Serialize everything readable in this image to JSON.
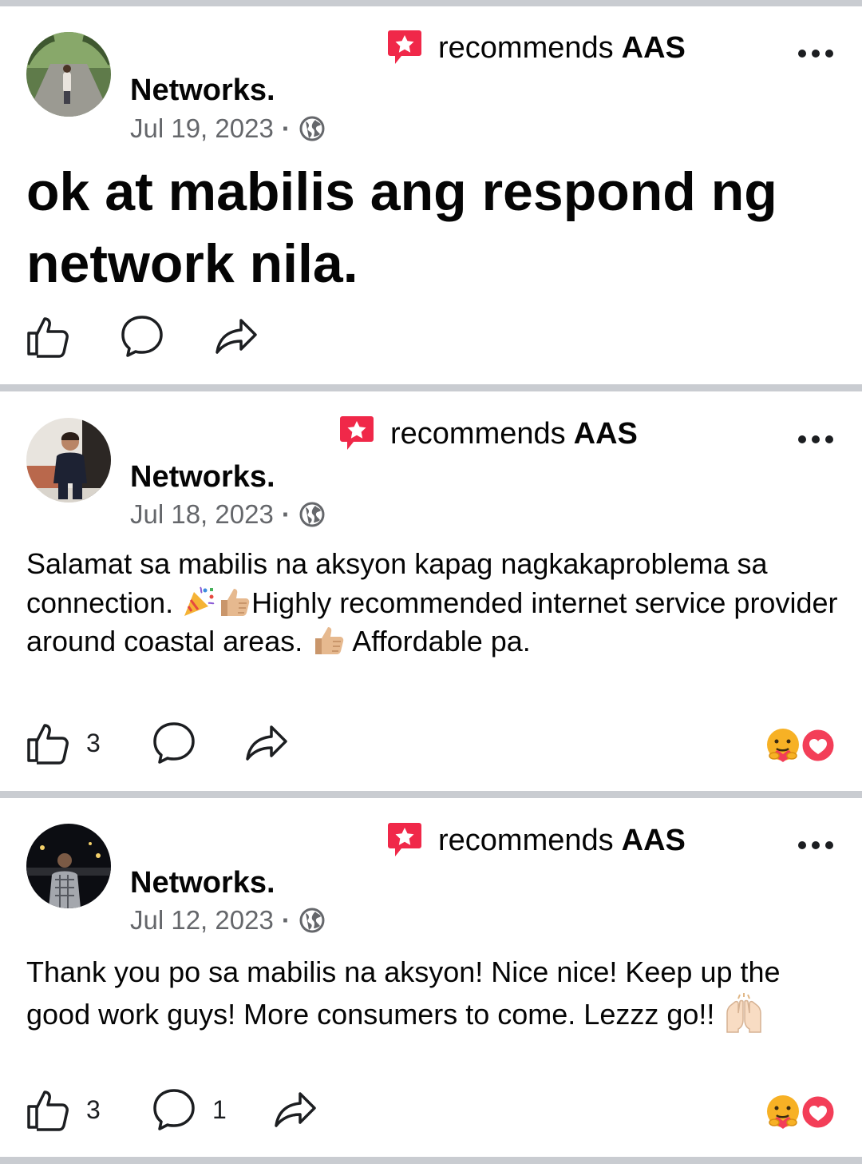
{
  "posts": [
    {
      "name": "Networks.",
      "recommends_prefix": "recommends",
      "page_name": "AAS",
      "date": "Jul 19, 2023",
      "text": "ok at mabilis ang respond ng network nila."
    },
    {
      "name": "Networks.",
      "recommends_prefix": "recommends",
      "page_name": "AAS",
      "date": "Jul 18, 2023",
      "text_1": "Salamat sa mabilis na aksyon kapag nagkakaproblema sa connection.",
      "text_2": "Highly recommended internet service provider around coastal areas.",
      "text_3": "Affordable pa.",
      "like_count": "3",
      "emojis": [
        "party-popper",
        "thumbs-up",
        "thumbs-up"
      ],
      "reactions": [
        "care",
        "love"
      ]
    },
    {
      "name": "Networks.",
      "recommends_prefix": "recommends",
      "page_name": "AAS",
      "date": "Jul 12, 2023",
      "text": "Thank you po sa mabilis na aksyon! Nice nice! Keep up the good work guys! More consumers to come. Lezzz go!!",
      "like_count": "3",
      "comment_count": "1",
      "emojis": [
        "raising-hands"
      ],
      "reactions": [
        "care",
        "love"
      ]
    }
  ],
  "colors": {
    "divider": "#c9ccd1",
    "recommend_red": "#f02849",
    "meta_gray": "#65676b",
    "love_red": "#f33e58",
    "care_yellow": "#f7b125"
  }
}
